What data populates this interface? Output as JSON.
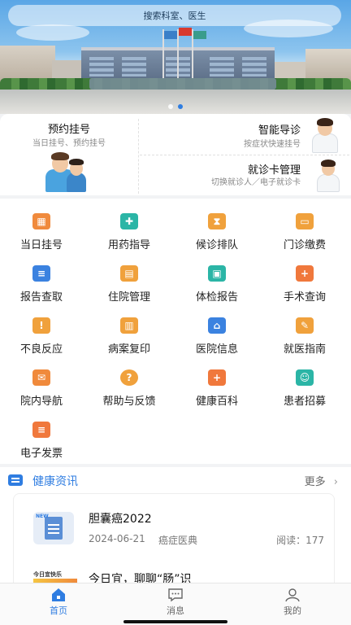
{
  "search": {
    "placeholder": "搜索科室、医生"
  },
  "banner": {
    "slides": 2,
    "active_slide": 2
  },
  "quick": {
    "appointment": {
      "title": "预约挂号",
      "subtitle": "当日挂号、预约挂号"
    },
    "smart_guide": {
      "title": "智能导诊",
      "subtitle": "按症状快速挂号"
    },
    "card_mgmt": {
      "title": "就诊卡管理",
      "subtitle": "切换就诊人／电子就诊卡"
    }
  },
  "grid": [
    {
      "label": "当日挂号",
      "icon": "calendar-icon",
      "color": "#f08a3c"
    },
    {
      "label": "用药指导",
      "icon": "pill-icon",
      "color": "#2bb5a6"
    },
    {
      "label": "候诊排队",
      "icon": "hourglass-icon",
      "color": "#f0a13c"
    },
    {
      "label": "门诊缴费",
      "icon": "wallet-icon",
      "color": "#f0a13c"
    },
    {
      "label": "报告查取",
      "icon": "report-search-icon",
      "color": "#3b82e0"
    },
    {
      "label": "住院管理",
      "icon": "inpatient-icon",
      "color": "#f0a13c"
    },
    {
      "label": "体检报告",
      "icon": "checkup-icon",
      "color": "#2bb5a6"
    },
    {
      "label": "手术查询",
      "icon": "surgery-icon",
      "color": "#f0783c"
    },
    {
      "label": "不良反应",
      "icon": "warning-user-icon",
      "color": "#f0a13c"
    },
    {
      "label": "病案复印",
      "icon": "printer-icon",
      "color": "#f0a13c"
    },
    {
      "label": "医院信息",
      "icon": "hospital-icon",
      "color": "#3b82e0"
    },
    {
      "label": "就医指南",
      "icon": "guide-icon",
      "color": "#f0a13c"
    },
    {
      "label": "院内导航",
      "icon": "map-icon",
      "color": "#f08a3c"
    },
    {
      "label": "帮助与反馈",
      "icon": "help-icon",
      "color": "#f0a13c"
    },
    {
      "label": "健康百科",
      "icon": "encyclopedia-icon",
      "color": "#f0783c"
    },
    {
      "label": "患者招募",
      "icon": "recruit-icon",
      "color": "#2bb5a6"
    },
    {
      "label": "电子发票",
      "icon": "invoice-icon",
      "color": "#f0783c"
    }
  ],
  "news": {
    "title": "健康资讯",
    "more": "更多",
    "articles": [
      {
        "title": "胆囊癌2022",
        "date": "2024-06-21",
        "source": "癌症医典",
        "reads": "阅读：177",
        "thumb_label": "NEW"
      },
      {
        "title": "今日宜，聊聊“肠”识",
        "thumb_label": "今日宜快乐"
      }
    ]
  },
  "tabs": [
    {
      "label": "首页",
      "icon": "home-icon",
      "active": true
    },
    {
      "label": "消息",
      "icon": "message-icon",
      "active": false
    },
    {
      "label": "我的",
      "icon": "profile-icon",
      "active": false
    }
  ],
  "colors": {
    "accent": "#2f7de1"
  }
}
